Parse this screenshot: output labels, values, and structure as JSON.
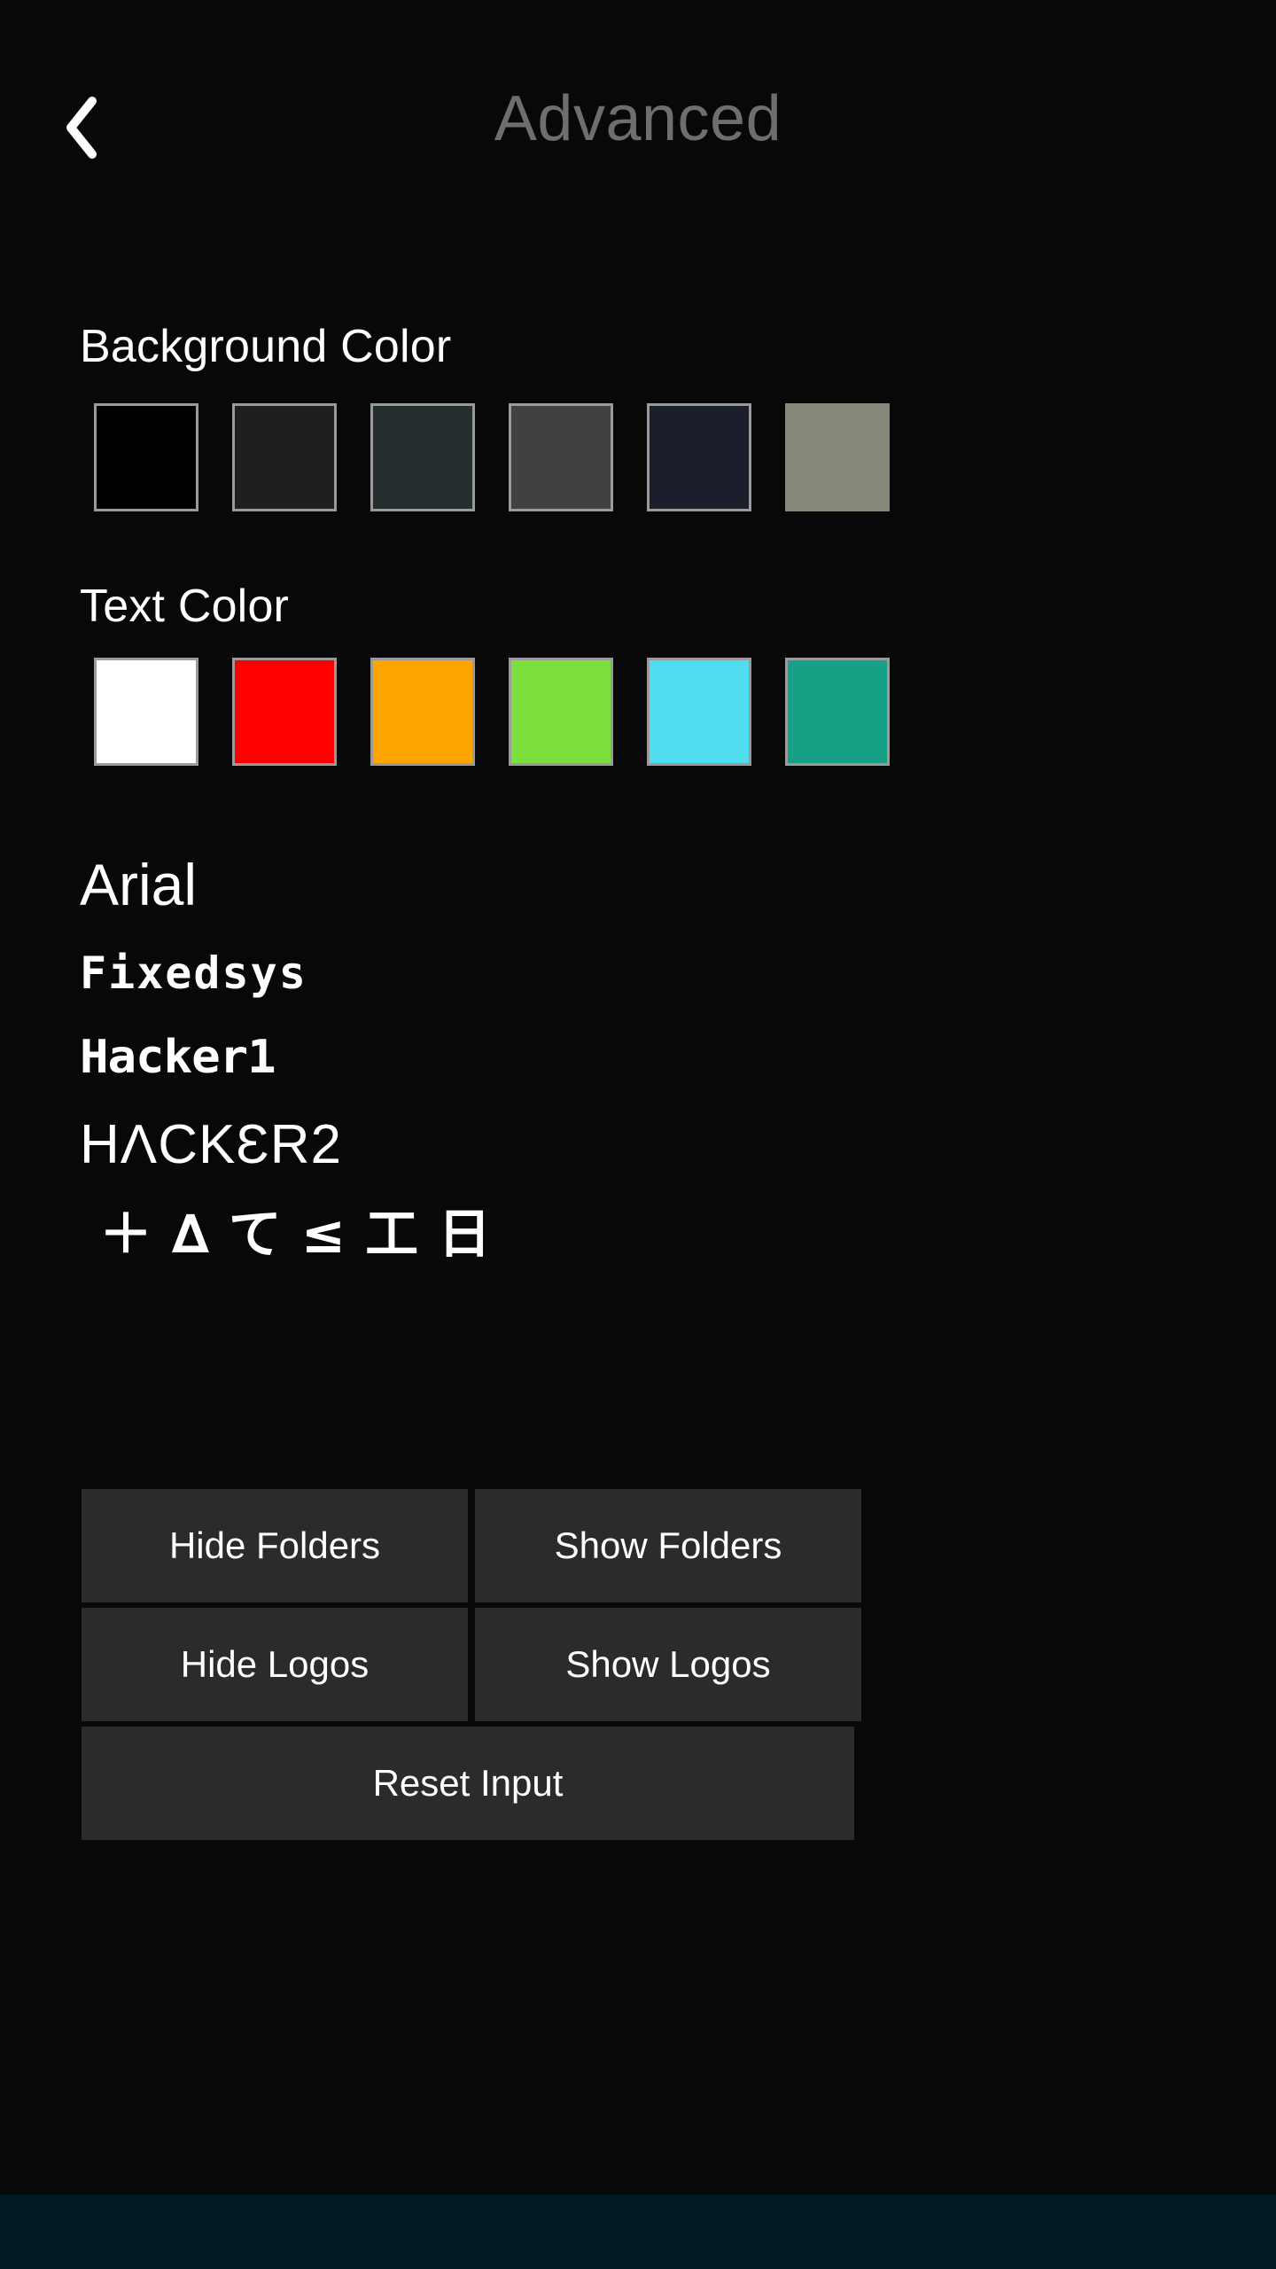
{
  "header": {
    "title": "Advanced",
    "back_icon": "chevron-left-icon",
    "title_color": "#6e6e6e"
  },
  "background_color_section": {
    "label": "Background Color",
    "swatches": [
      {
        "name": "black",
        "hex": "#000000",
        "bordered": true
      },
      {
        "name": "dark-gray",
        "hex": "#1f1f1f",
        "bordered": true
      },
      {
        "name": "dark-slate",
        "hex": "#262f30",
        "bordered": true
      },
      {
        "name": "gray",
        "hex": "#414141",
        "bordered": true
      },
      {
        "name": "dark-navy",
        "hex": "#1a1f2b",
        "bordered": true
      },
      {
        "name": "khaki",
        "hex": "#87877a",
        "bordered": false
      }
    ]
  },
  "text_color_section": {
    "label": "Text Color",
    "swatches": [
      {
        "name": "white",
        "hex": "#ffffff",
        "bordered": true
      },
      {
        "name": "red",
        "hex": "#ff0000",
        "bordered": true
      },
      {
        "name": "orange",
        "hex": "#ffa500",
        "bordered": true
      },
      {
        "name": "green",
        "hex": "#7ce03c",
        "bordered": true
      },
      {
        "name": "cyan",
        "hex": "#52dcf0",
        "bordered": true
      },
      {
        "name": "teal",
        "hex": "#16a085",
        "bordered": true
      }
    ]
  },
  "font_section": {
    "samples": [
      {
        "name": "arial",
        "label": "Arial"
      },
      {
        "name": "fixedsys",
        "label": "Fixedsys"
      },
      {
        "name": "hacker1",
        "label": "Hacker1"
      },
      {
        "name": "hacker2",
        "label": "HΛCKƐR2"
      },
      {
        "name": "symbols",
        "label": "＋∆て≤工日"
      }
    ]
  },
  "buttons": {
    "hide_folders": "Hide Folders",
    "show_folders": "Show Folders",
    "hide_logos": "Hide Logos",
    "show_logos": "Show Logos",
    "reset_input": "Reset Input",
    "background": "#2b2b2b",
    "text_color": "#ffffff"
  },
  "bottom_strip": {
    "color": "#001a22"
  },
  "page": {
    "background": "#080808"
  }
}
